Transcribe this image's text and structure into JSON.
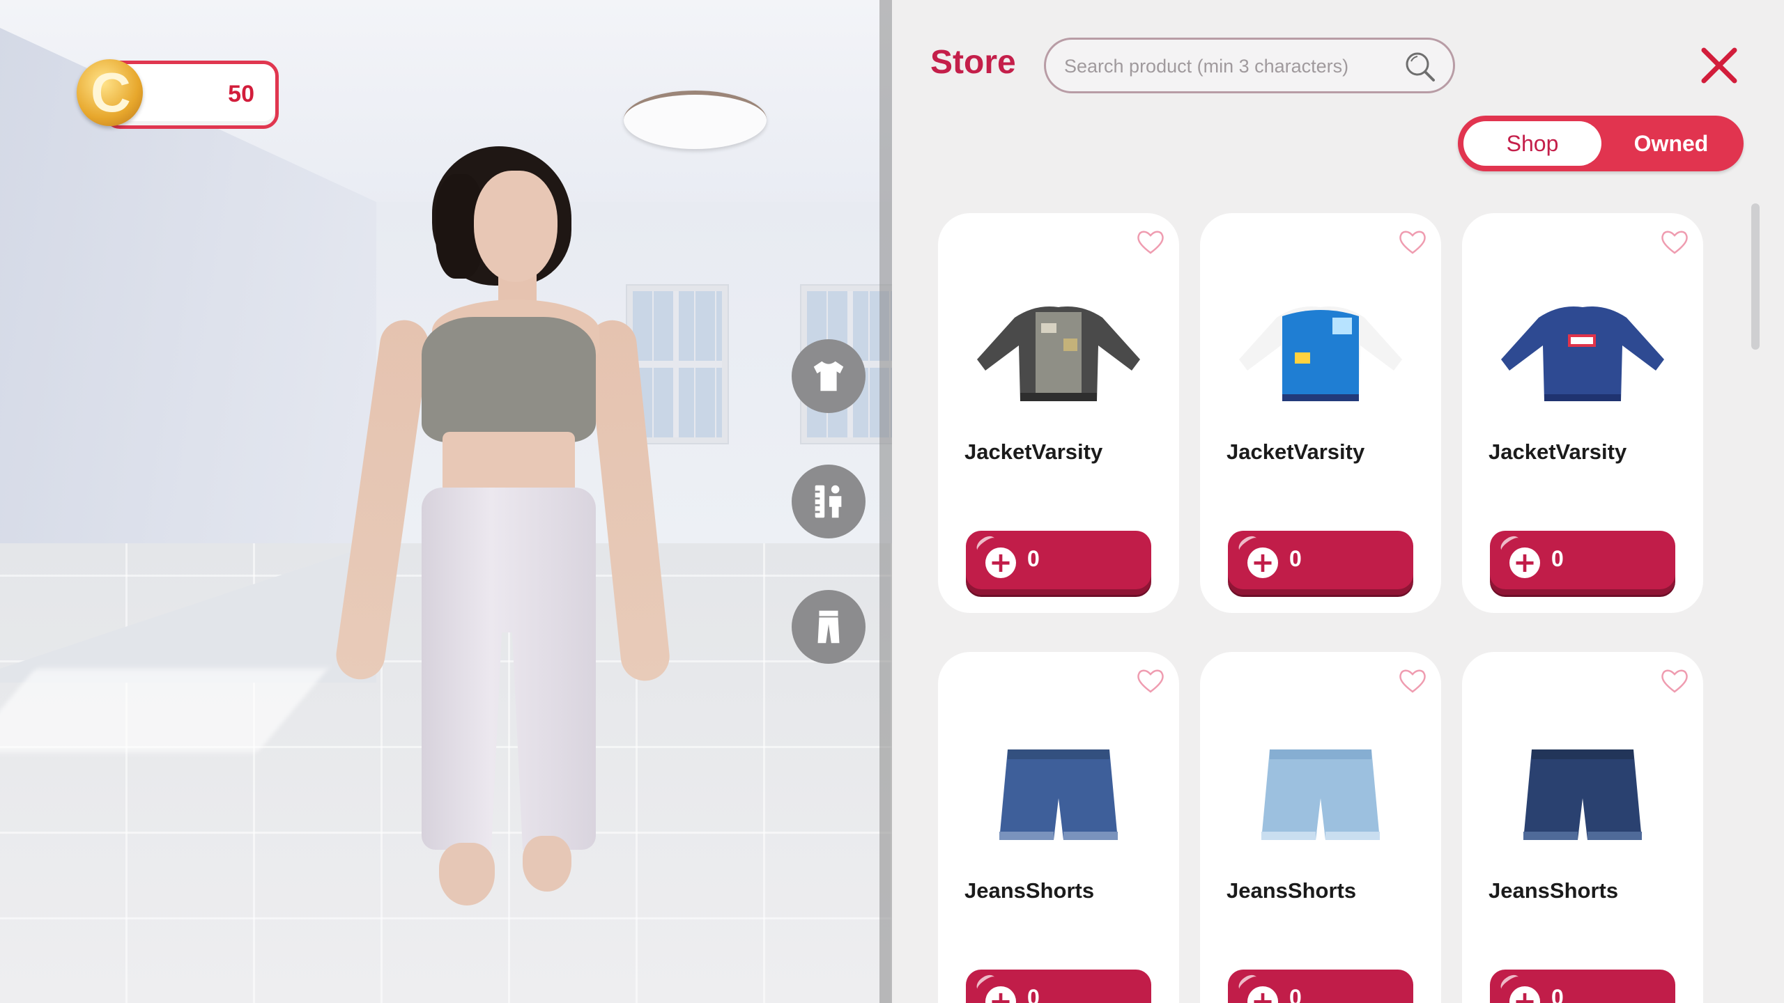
{
  "hud": {
    "coins": "50",
    "coin_letter": "C"
  },
  "tools": [
    {
      "name": "clothing-tool-button",
      "icon": "tshirt-icon"
    },
    {
      "name": "body-measure-tool-button",
      "icon": "ruler-person-icon"
    },
    {
      "name": "pants-tool-button",
      "icon": "pants-icon"
    }
  ],
  "store": {
    "title": "Store",
    "search_placeholder": "Search product (min 3 characters)",
    "search_value": "",
    "tabs": {
      "shop": "Shop",
      "owned": "Owned",
      "active": "Shop"
    },
    "colors": {
      "accent": "#c41f4a",
      "toggle": "#e1344f",
      "button": "#c11d49"
    },
    "products": [
      {
        "name": "JacketVarsity",
        "price": "0",
        "plus": "+",
        "thumb": "jacket-varsity-black-icon"
      },
      {
        "name": "JacketVarsity",
        "price": "0",
        "plus": "+",
        "thumb": "jacket-varsity-blue-white-icon"
      },
      {
        "name": "JacketVarsity",
        "price": "0",
        "plus": "+",
        "thumb": "jacket-varsity-navy-icon"
      },
      {
        "name": "JeansShorts",
        "price": "0",
        "plus": "+",
        "thumb": "jeans-shorts-medium-icon"
      },
      {
        "name": "JeansShorts",
        "price": "0",
        "plus": "+",
        "thumb": "jeans-shorts-light-icon"
      },
      {
        "name": "JeansShorts",
        "price": "0",
        "plus": "+",
        "thumb": "jeans-shorts-dark-icon"
      }
    ]
  }
}
